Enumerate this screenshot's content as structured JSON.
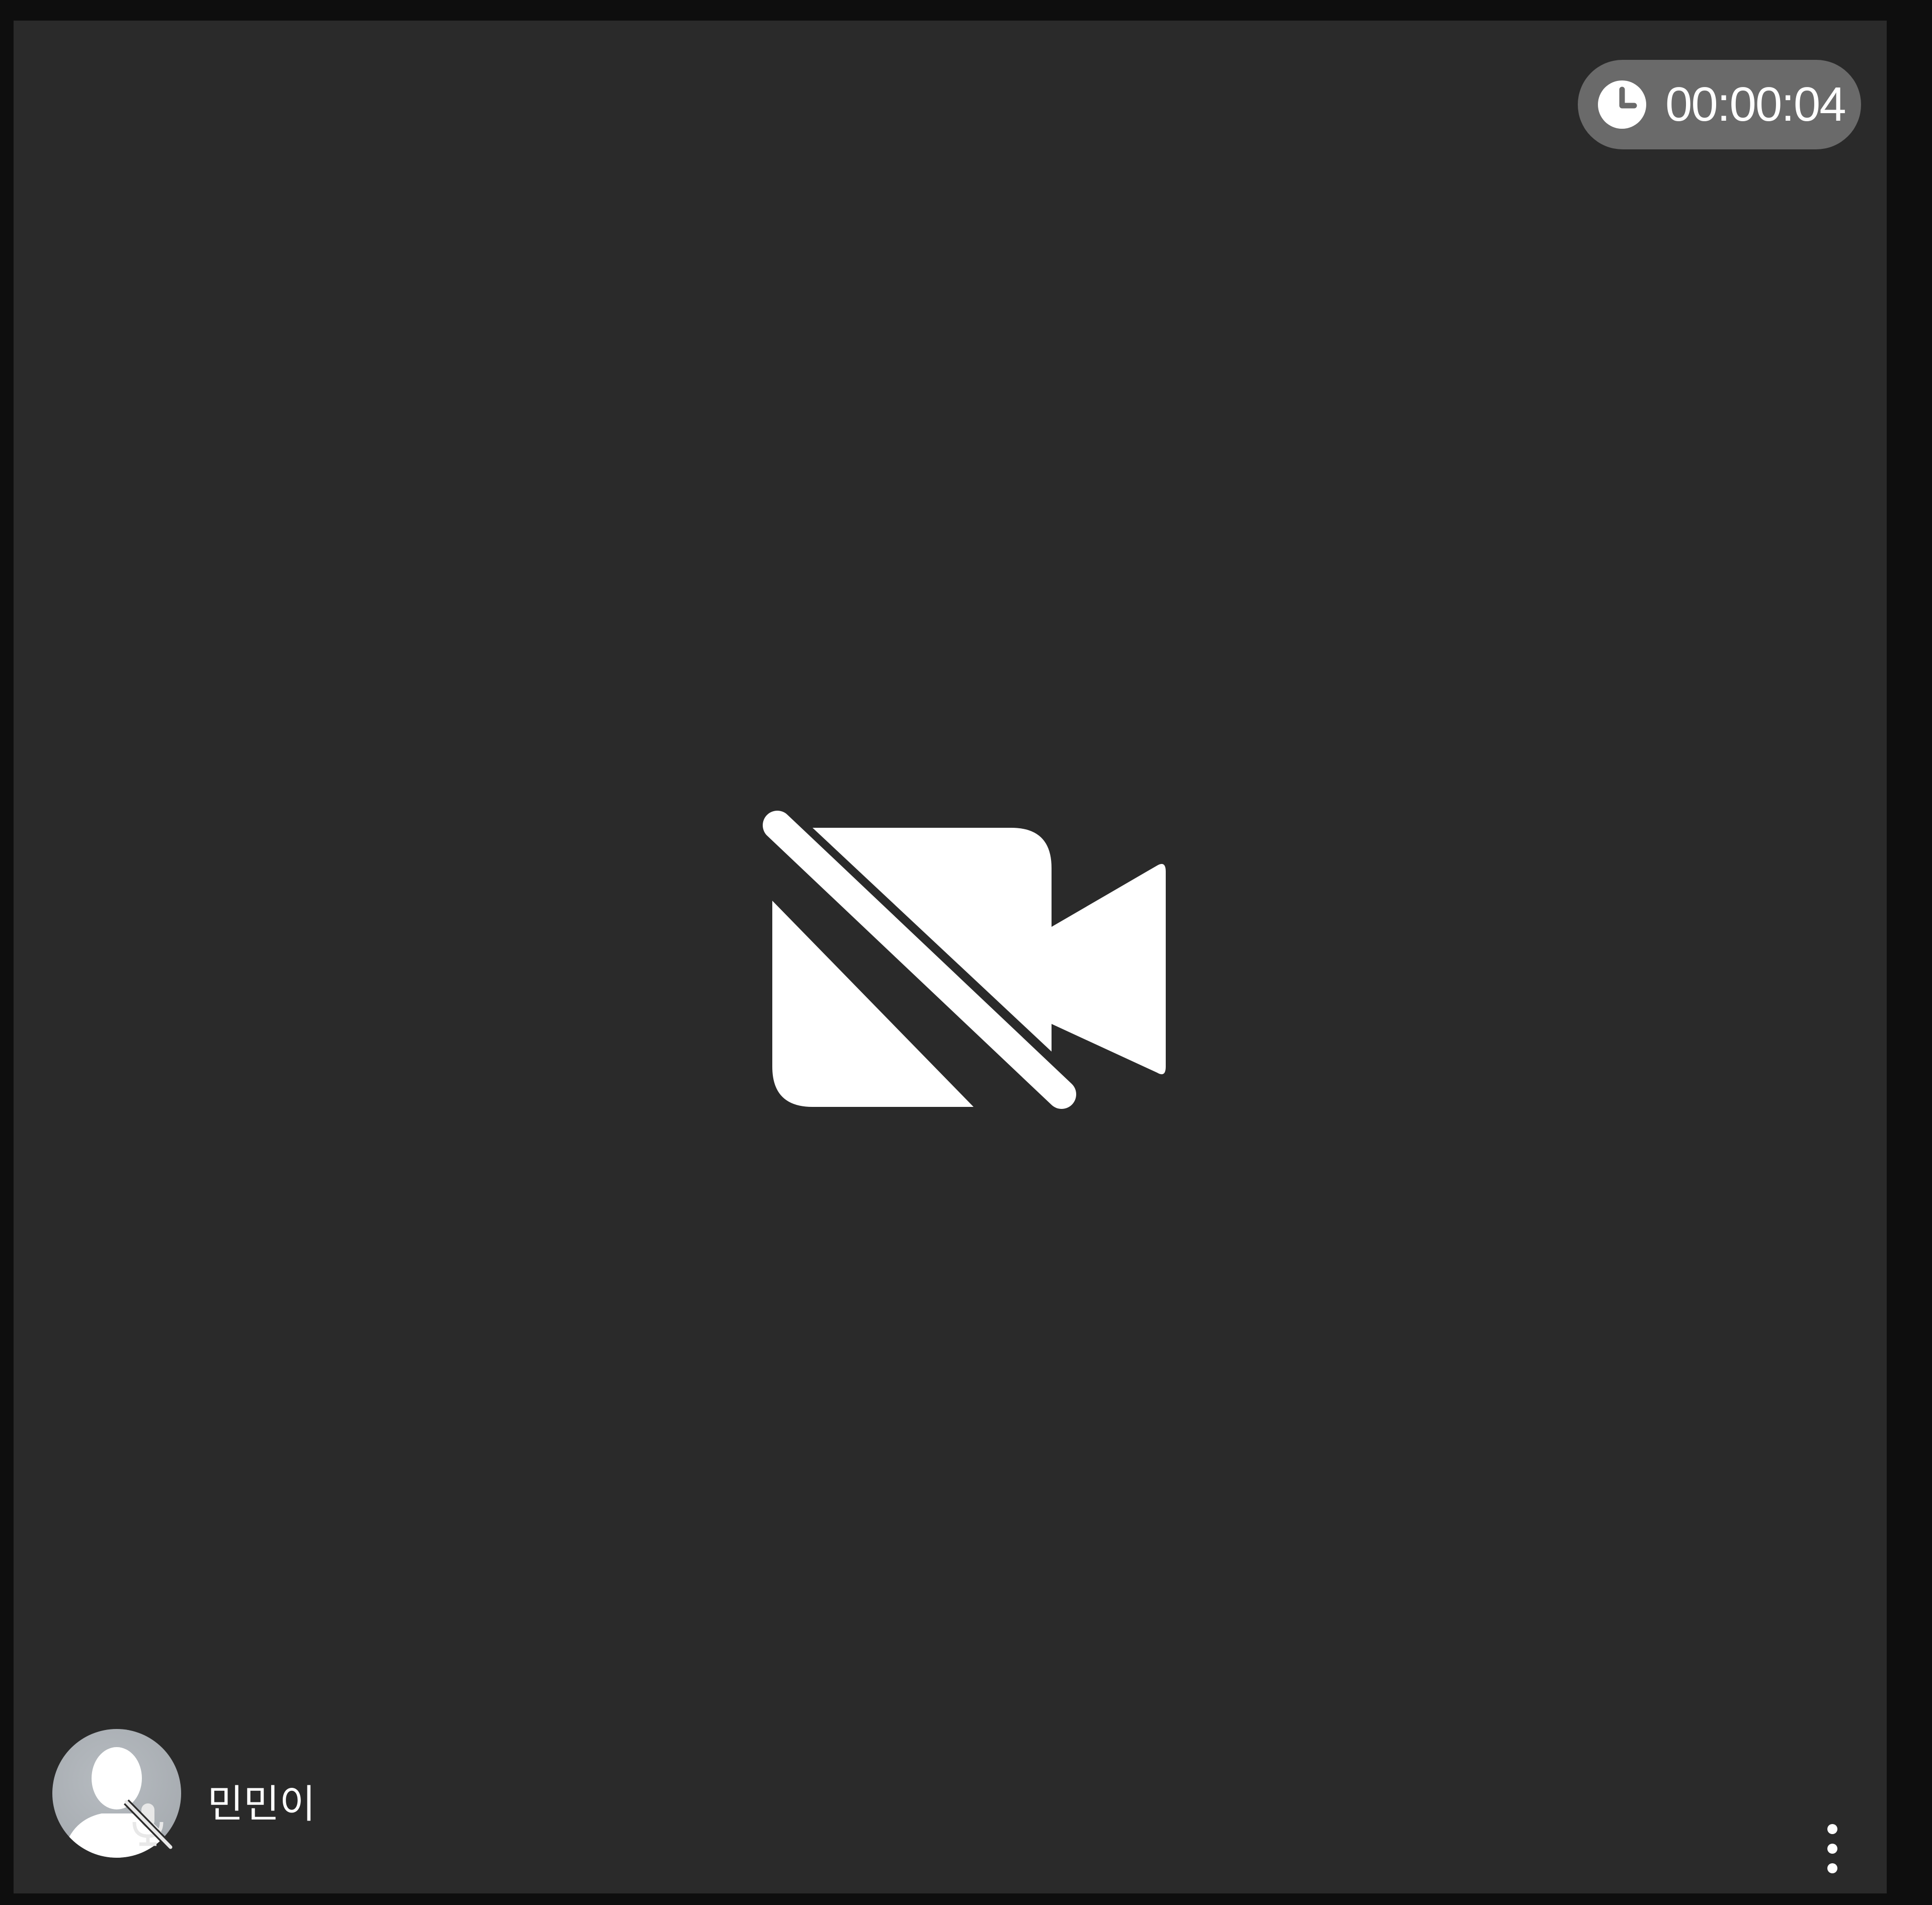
{
  "call": {
    "elapsed_time": "00:00:04",
    "camera_state_icon": "video-off-icon"
  },
  "participant": {
    "name": "민민이",
    "avatar_icon": "default-user-avatar",
    "mic_state_icon": "mic-off-icon"
  },
  "controls": {
    "more_icon": "more-vertical-icon"
  },
  "colors": {
    "tile_background": "#2a2a2a",
    "page_background": "#0e0e0e",
    "timer_background": "#6a6a6a",
    "icon_color": "#ffffff"
  }
}
